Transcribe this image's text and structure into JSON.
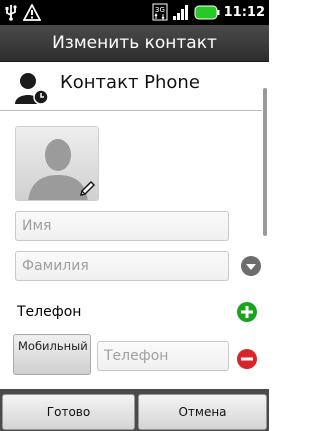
{
  "status_bar": {
    "time": "11:12",
    "icons": [
      "usb-icon",
      "warning-icon",
      "3g-icon",
      "signal-icon",
      "battery-icon"
    ],
    "network_label": "3G"
  },
  "title_bar": {
    "title": "Изменить контакт"
  },
  "account": {
    "title": "Контакт Phone",
    "icon": "contact-account-icon"
  },
  "fields": {
    "first_name_placeholder": "Имя",
    "last_name_placeholder": "Фамилия"
  },
  "phone_section": {
    "label": "Телефон",
    "type_button": "Мобильный",
    "phone_placeholder": "Телефон"
  },
  "bottom_bar": {
    "done": "Готово",
    "cancel": "Отмена"
  },
  "colors": {
    "add": "#1aa31f",
    "remove": "#d9252a",
    "battery": "#28c828",
    "titlebar": "#3a3a3a"
  }
}
